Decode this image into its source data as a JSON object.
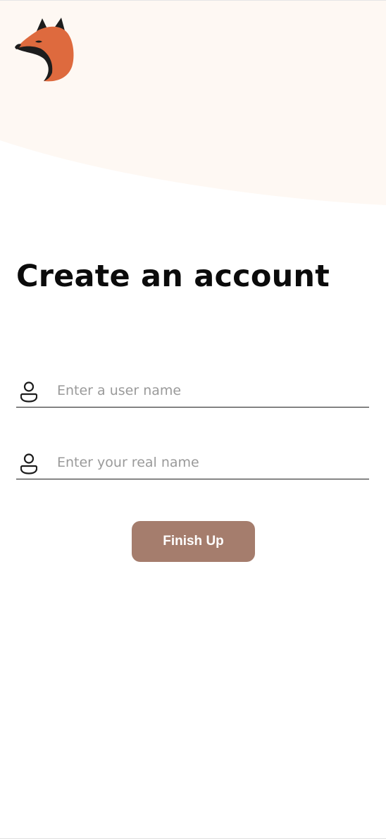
{
  "header": {
    "logo_icon": "fox-logo-icon"
  },
  "main": {
    "title": "Create an account",
    "fields": {
      "username": {
        "icon": "person-icon",
        "placeholder": "Enter a user name",
        "value": ""
      },
      "realname": {
        "icon": "person-icon",
        "placeholder": "Enter your real name",
        "value": ""
      }
    },
    "finish_button": {
      "label": "Finish Up"
    }
  },
  "colors": {
    "hero_background": "#fef8f3",
    "button": "#a57d6d",
    "fox_orange": "#de6a3e",
    "text_dark": "#0b0b0b",
    "placeholder": "#9a9a9a"
  }
}
